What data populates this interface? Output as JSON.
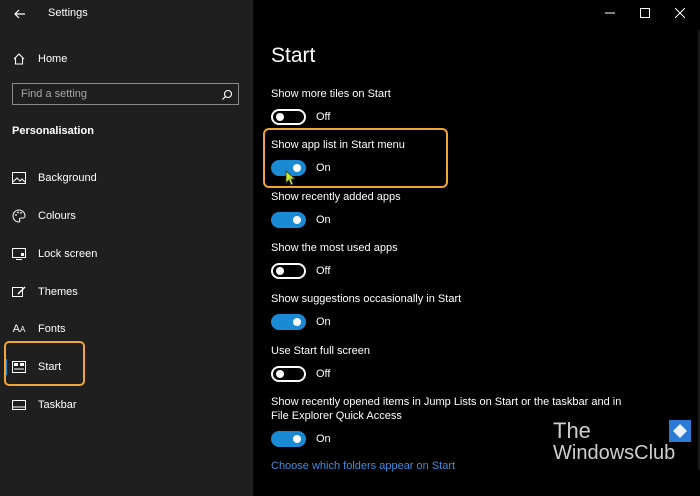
{
  "window": {
    "title": "Settings",
    "minimize_glyph": "—",
    "maximize_glyph": "☐",
    "close_glyph": "✕"
  },
  "sidebar": {
    "home_label": "Home",
    "search_placeholder": "Find a setting",
    "section_label": "Personalisation",
    "items": [
      {
        "label": "Background",
        "icon": "background-image-icon"
      },
      {
        "label": "Colours",
        "icon": "palette-icon"
      },
      {
        "label": "Lock screen",
        "icon": "lock-screen-icon"
      },
      {
        "label": "Themes",
        "icon": "themes-brush-icon"
      },
      {
        "label": "Fonts",
        "icon": "fonts-icon"
      },
      {
        "label": "Start",
        "icon": "start-menu-icon",
        "selected": true
      },
      {
        "label": "Taskbar",
        "icon": "taskbar-icon"
      }
    ]
  },
  "main": {
    "title": "Start",
    "settings": [
      {
        "title": "Show more tiles on Start",
        "state": "Off",
        "on": false
      },
      {
        "title": "Show app list in Start menu",
        "state": "On",
        "on": true
      },
      {
        "title": "Show recently added apps",
        "state": "On",
        "on": true
      },
      {
        "title": "Show the most used apps",
        "state": "Off",
        "on": false
      },
      {
        "title": "Show suggestions occasionally in Start",
        "state": "On",
        "on": true
      },
      {
        "title": "Use Start full screen",
        "state": "Off",
        "on": false
      },
      {
        "title": "Show recently opened items in Jump Lists on Start or the taskbar and in",
        "title_line2": "File Explorer Quick Access",
        "state": "On",
        "on": true
      }
    ],
    "link": "Choose which folders appear on Start"
  },
  "watermark": {
    "line1": "The",
    "line2": "WindowsClub"
  },
  "colors": {
    "accent": "#1a8ad4",
    "highlight": "#f0a534",
    "link": "#3b8ee0",
    "sidebar_bg": "#1f1f1f",
    "main_bg": "#000000"
  }
}
